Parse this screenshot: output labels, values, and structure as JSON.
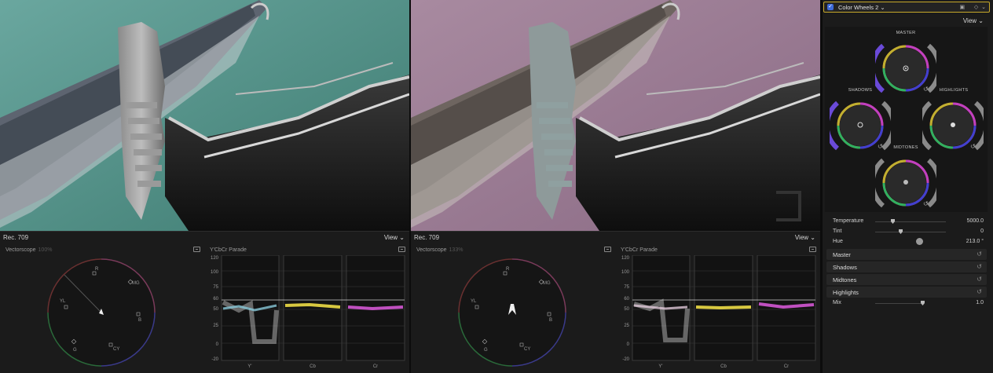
{
  "viewer": {
    "left_label": "Rec. 709",
    "right_label": "Rec. 709",
    "view_label": "View"
  },
  "scopes": {
    "left": {
      "vectorscope_title": "Vectorscope",
      "vectorscope_pct": "100%",
      "parade_title": "Y'CbCr Parade"
    },
    "right": {
      "vectorscope_title": "Vectorscope",
      "vectorscope_pct": "133%",
      "parade_title": "Y'CbCr Parade"
    },
    "vector_targets": [
      "R",
      "MG",
      "B",
      "CY",
      "G",
      "YL"
    ],
    "parade_scale": [
      "120",
      "100",
      "75",
      "60",
      "50",
      "25",
      "0",
      "-20"
    ],
    "parade_channels": [
      "Y'",
      "Cb",
      "Cr"
    ]
  },
  "inspector": {
    "effect_name": "Color Wheels 2",
    "view_label": "View",
    "wheels": {
      "master": "MASTER",
      "shadows": "SHADOWS",
      "highlights": "HIGHLIGHTS",
      "midtones": "MIDTONES"
    },
    "params": {
      "temperature_label": "Temperature",
      "temperature_value": "5000.0",
      "tint_label": "Tint",
      "tint_value": "0",
      "hue_label": "Hue",
      "hue_value": "213.0 °",
      "mix_label": "Mix",
      "mix_value": "1.0"
    },
    "sections": [
      "Master",
      "Shadows",
      "Midtones",
      "Highlights"
    ]
  },
  "colors": {
    "water_left": "#4f8f86",
    "water_right": "#9a7a92",
    "highlight_border": "#c7a82a",
    "checkbox": "#3d6ad8",
    "cb_trace": "#d8c840",
    "cr_trace": "#c050c0"
  }
}
